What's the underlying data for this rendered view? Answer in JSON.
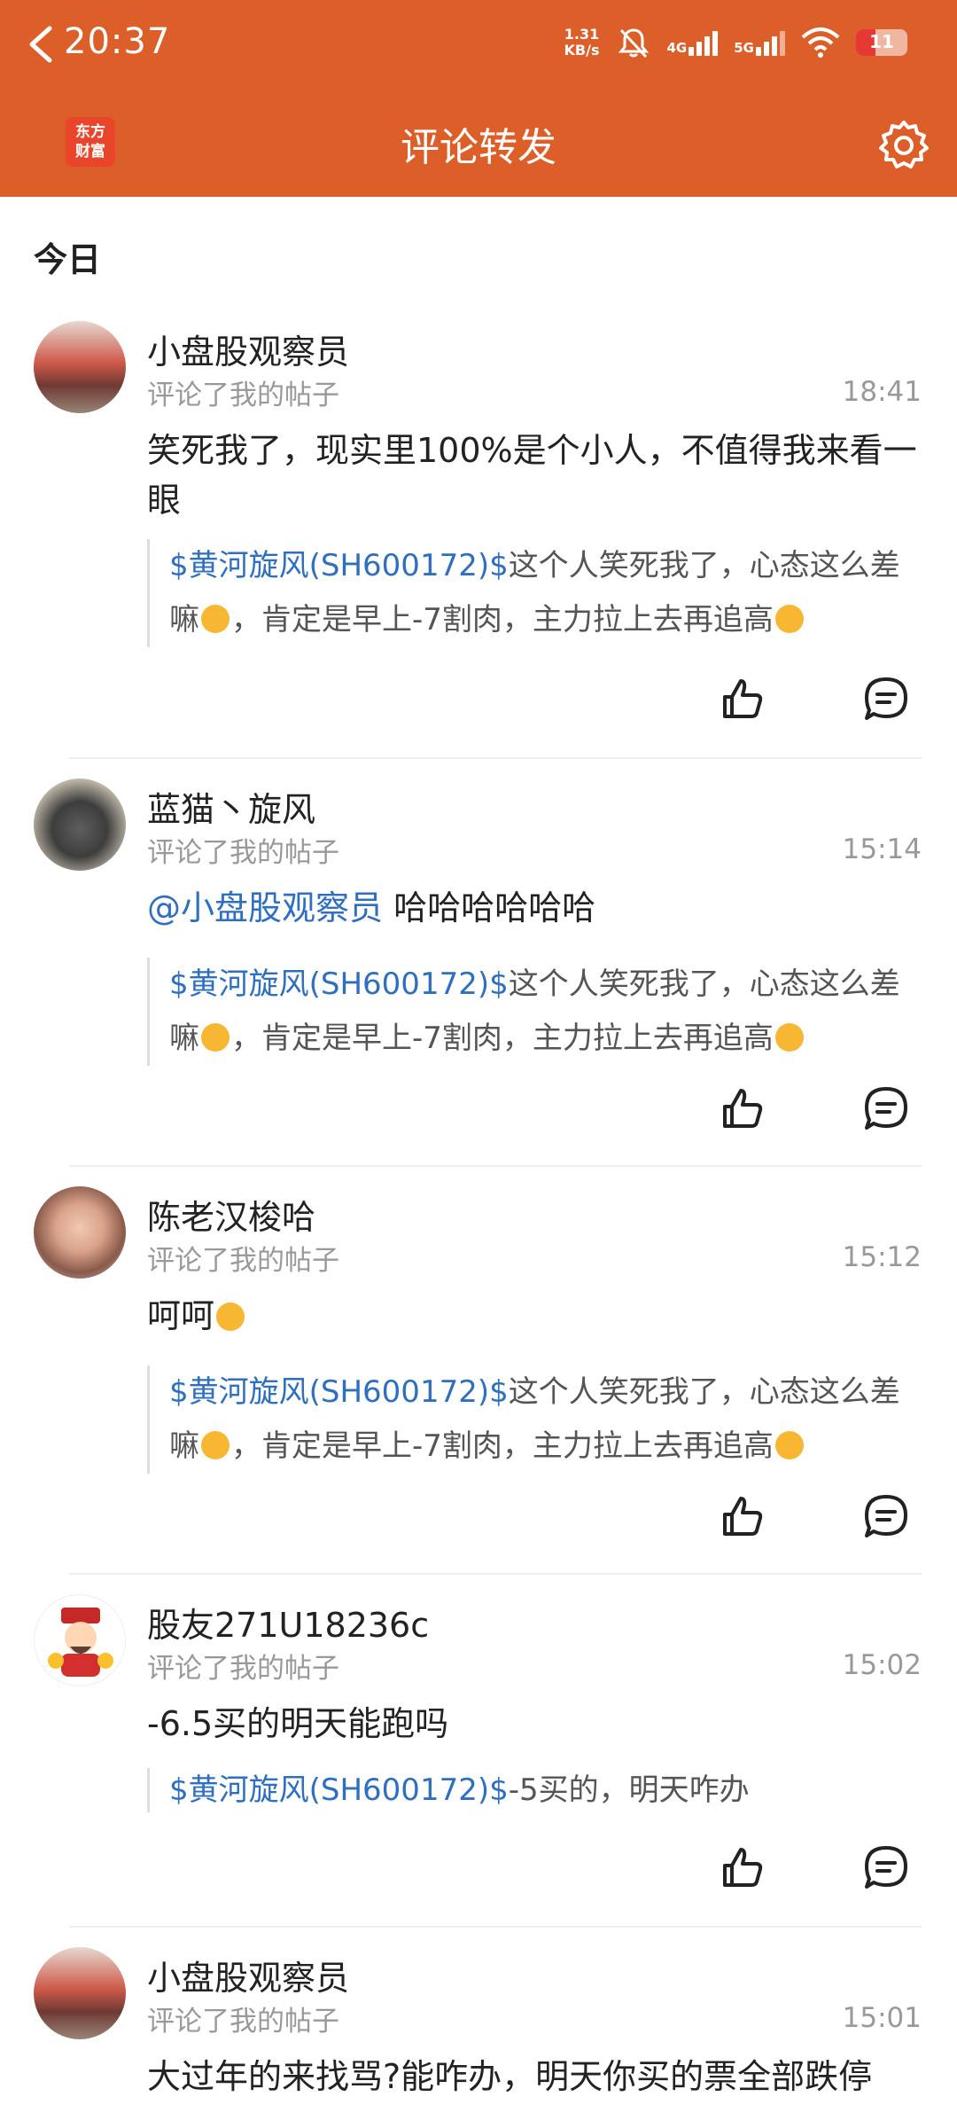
{
  "status": {
    "time": "20:37",
    "speed_value": "1.31",
    "speed_unit": "KB/s",
    "net1": "4G",
    "net2": "5G",
    "battery": "11"
  },
  "header": {
    "title": "评论转发",
    "logo_line1": "东方",
    "logo_line2": "财富"
  },
  "section": {
    "today": "今日"
  },
  "items": [
    {
      "user": "小盘股观察员",
      "action": "评论了我的帖子",
      "time": "18:41",
      "mention": "",
      "content": "笑死我了，现实里100%是个小人，不值得我来看一眼",
      "quote_tag": "$黄河旋风(SH600172)$",
      "quote_a": "这个人笑死我了，心态这么差嘛",
      "quote_b": "，肯定是早上-7割肉，主力拉上去再追高"
    },
    {
      "user": "蓝猫丶旋风",
      "action": "评论了我的帖子",
      "time": "15:14",
      "mention": "@小盘股观察员",
      "content": "哈哈哈哈哈哈",
      "quote_tag": "$黄河旋风(SH600172)$",
      "quote_a": "这个人笑死我了，心态这么差嘛",
      "quote_b": "，肯定是早上-7割肉，主力拉上去再追高"
    },
    {
      "user": "陈老汉梭哈",
      "action": "评论了我的帖子",
      "time": "15:12",
      "mention": "",
      "content": "呵呵",
      "quote_tag": "$黄河旋风(SH600172)$",
      "quote_a": "这个人笑死我了，心态这么差嘛",
      "quote_b": "，肯定是早上-7割肉，主力拉上去再追高"
    },
    {
      "user": "股友271U18236c",
      "action": "评论了我的帖子",
      "time": "15:02",
      "mention": "",
      "content": "-6.5买的明天能跑吗",
      "quote_tag": "$黄河旋风(SH600172)$",
      "quote_a": "-5买的，明天咋办",
      "quote_b": ""
    },
    {
      "user": "小盘股观察员",
      "action": "评论了我的帖子",
      "time": "15:01",
      "mention": "",
      "content": "大过年的来找骂?能咋办，明天你买的票全部跌停",
      "quote_tag": "",
      "quote_a": "",
      "quote_b": ""
    }
  ]
}
